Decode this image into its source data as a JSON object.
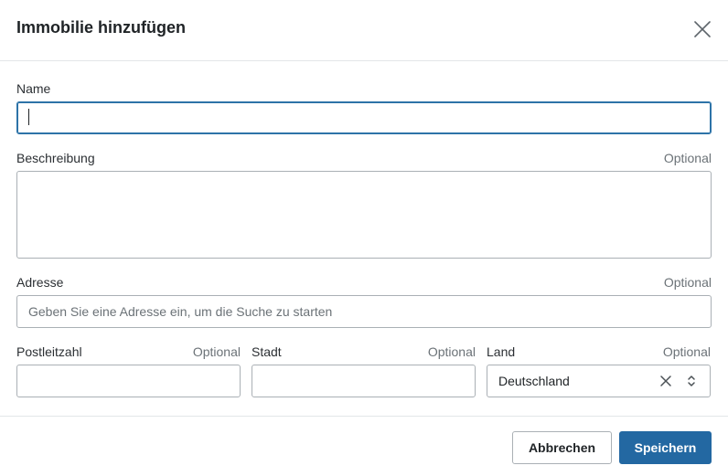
{
  "dialog": {
    "title": "Immobilie hinzufügen",
    "close_icon": "close-icon"
  },
  "form": {
    "name": {
      "label": "Name",
      "value": ""
    },
    "description": {
      "label": "Beschreibung",
      "optional": "Optional",
      "value": ""
    },
    "address": {
      "label": "Adresse",
      "optional": "Optional",
      "placeholder": "Geben Sie eine Adresse ein, um die Suche zu starten",
      "value": ""
    },
    "postal_code": {
      "label": "Postleitzahl",
      "optional": "Optional",
      "value": ""
    },
    "city": {
      "label": "Stadt",
      "optional": "Optional",
      "value": ""
    },
    "country": {
      "label": "Land",
      "optional": "Optional",
      "value": "Deutschland",
      "clear_icon": "clear-icon",
      "toggle_icon": "chevron-up-down-icon"
    }
  },
  "footer": {
    "cancel_label": "Abbrechen",
    "save_label": "Speichern"
  },
  "colors": {
    "primary": "#2368a2",
    "focus": "#2d73a8",
    "border": "#aab0b5",
    "muted_text": "#6b7277"
  }
}
